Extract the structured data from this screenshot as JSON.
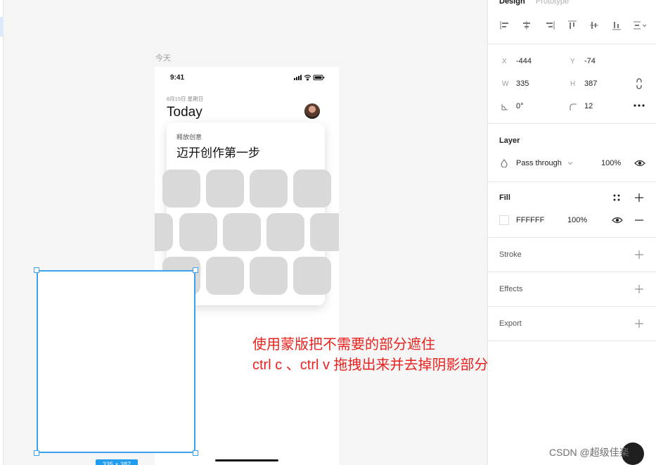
{
  "canvas": {
    "frame_label": "今天",
    "phone": {
      "status_time": "9:41",
      "date_line": "8月15日 星期日",
      "title": "Today",
      "card": {
        "subtitle": "释放创意",
        "title": "迈开创作第一步"
      }
    },
    "selection": {
      "size_label": "335 × 387"
    },
    "annotation": {
      "line1": "使用蒙版把不需要的部分遮住",
      "line2": "ctrl c 、ctrl v 拖拽出来并去掉阴影部分"
    }
  },
  "panel": {
    "tabs": [
      "Design",
      "Prototype"
    ],
    "position": {
      "x_label": "X",
      "x_value": "-444",
      "y_label": "Y",
      "y_value": "-74",
      "w_label": "W",
      "w_value": "335",
      "h_label": "H",
      "h_value": "387",
      "rotation_value": "0°",
      "radius_value": "12"
    },
    "layer": {
      "title": "Layer",
      "blend_mode": "Pass through",
      "opacity": "100%"
    },
    "fill": {
      "title": "Fill",
      "color_hex": "FFFFFF",
      "opacity": "100%"
    },
    "stroke": {
      "title": "Stroke"
    },
    "effects": {
      "title": "Effects"
    },
    "export": {
      "title": "Export"
    }
  },
  "watermark": "CSDN @超级佳楽",
  "colors": {
    "selection_blue": "#3ea2ea",
    "annotation_red": "#e8231f",
    "tile_gray": "#d9d9d9"
  }
}
